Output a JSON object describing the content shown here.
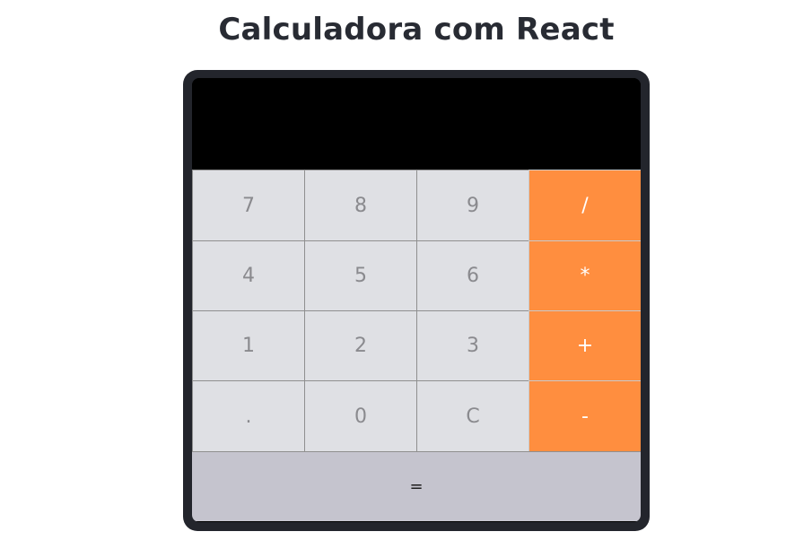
{
  "page": {
    "title": "Calculadora com React"
  },
  "calculator": {
    "display_value": "",
    "keys": {
      "k7": "7",
      "k8": "8",
      "k9": "9",
      "div": "/",
      "k4": "4",
      "k5": "5",
      "k6": "6",
      "mul": "*",
      "k1": "1",
      "k2": "2",
      "k3": "3",
      "add": "+",
      "dot": ".",
      "k0": "0",
      "clear": "C",
      "sub": "-",
      "equals": "="
    },
    "colors": {
      "frame": "#23252c",
      "display_bg": "#000000",
      "digit_key_bg": "#dfe0e4",
      "operator_key_bg": "#ff8e3f",
      "equals_key_bg": "#c5c4ce"
    }
  }
}
